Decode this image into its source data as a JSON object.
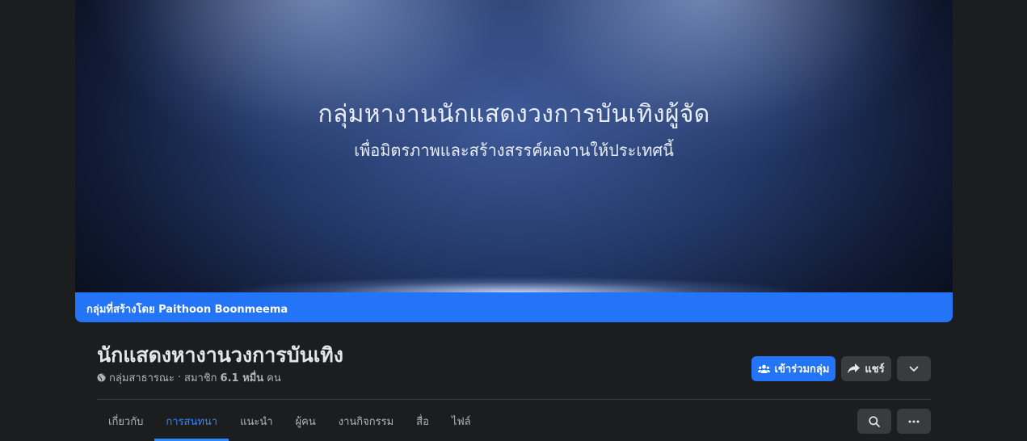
{
  "cover": {
    "title": "กลุ่มหางานนักแสดงวงการบันเทิงผู้จัด",
    "subtitle": "เพื่อมิตรภาพและสร้างสรรค์ผลงานให้ประเทศนี้"
  },
  "created_by": "กลุ่มที่สร้างโดย Paithoon Boonmeema",
  "group": {
    "name": "นักแสดงหางานวงการบันเทิง",
    "privacy": "กลุ่มสาธารณะ",
    "separator": "·",
    "members_prefix": "สมาชิก",
    "members_count": "6.1 หมื่น",
    "members_suffix": "คน"
  },
  "actions": {
    "join_label": "เข้าร่วมกลุ่ม",
    "share_label": "แชร์"
  },
  "tabs": [
    {
      "label": "เกี่ยวกับ"
    },
    {
      "label": "การสนทนา"
    },
    {
      "label": "แนะนำ"
    },
    {
      "label": "ผู้คน"
    },
    {
      "label": "งานกิจกรรม"
    },
    {
      "label": "สื่อ"
    },
    {
      "label": "ไฟล์"
    }
  ],
  "active_tab": "การสนทนา",
  "colors": {
    "accent": "#2374f7",
    "active_tab": "#2d88ff",
    "background": "#1c1d1f"
  }
}
